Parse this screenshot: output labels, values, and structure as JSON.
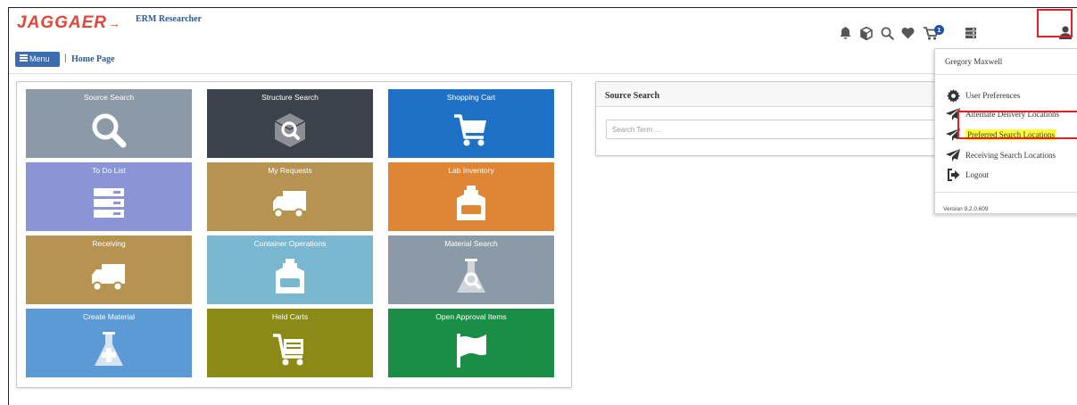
{
  "brand": {
    "logo": "JAGGAER",
    "app_name": "ERM Researcher"
  },
  "nav": {
    "menu_label": "Menu",
    "separator": "|",
    "breadcrumb": "Home Page"
  },
  "header_icons": [
    {
      "name": "bell-icon"
    },
    {
      "name": "cube-icon"
    },
    {
      "name": "search-icon"
    },
    {
      "name": "heart-icon"
    },
    {
      "name": "cart-icon",
      "badge": "1"
    },
    {
      "name": "server-icon"
    },
    {
      "name": "user-icon"
    }
  ],
  "tiles": [
    {
      "label": "Source Search",
      "icon": "search-icon",
      "color": "#8c99a6"
    },
    {
      "label": "Structure Search",
      "icon": "cube-search-icon",
      "color": "#3b4249"
    },
    {
      "label": "Shopping Cart",
      "icon": "cart-icon",
      "color": "#1f70c7"
    },
    {
      "label": "To Do List",
      "icon": "list-icon",
      "color": "#8a94d6"
    },
    {
      "label": "My Requests",
      "icon": "truck-icon",
      "color": "#b69350"
    },
    {
      "label": "Lab Inventory",
      "icon": "weight-icon",
      "color": "#de8636"
    },
    {
      "label": "Receiving",
      "icon": "truck-icon",
      "color": "#b69350"
    },
    {
      "label": "Container Operations",
      "icon": "weight-icon",
      "color": "#7ab7d1"
    },
    {
      "label": "Material Search",
      "icon": "flask-search-icon",
      "color": "#8c99a6"
    },
    {
      "label": "Create Material",
      "icon": "flask-plus-icon",
      "color": "#5b9ad5"
    },
    {
      "label": "Held Carts",
      "icon": "held-cart-icon",
      "color": "#8c8a16"
    },
    {
      "label": "Open Approval Items",
      "icon": "flag-icon",
      "color": "#1a8e44"
    }
  ],
  "source_search": {
    "title": "Source Search",
    "placeholder": "Search Term ..."
  },
  "user_menu": {
    "user_name": "Gregory Maxwell",
    "items": [
      {
        "label": "User Preferences",
        "icon": "gear-icon"
      },
      {
        "label": "Alternate Delivery Locations",
        "icon": "paper-plane-icon"
      },
      {
        "label": "Preferred Search Locations",
        "icon": "paper-plane-icon",
        "highlighted": true
      },
      {
        "label": "Receiving Search Locations",
        "icon": "paper-plane-icon"
      },
      {
        "label": "Logout",
        "icon": "logout-icon"
      }
    ],
    "version": "Version 9.2.0.609"
  },
  "colors": {
    "accent": "#2a5b95",
    "highlight_border": "#e32028",
    "highlight_fill": "#ffff3a"
  }
}
